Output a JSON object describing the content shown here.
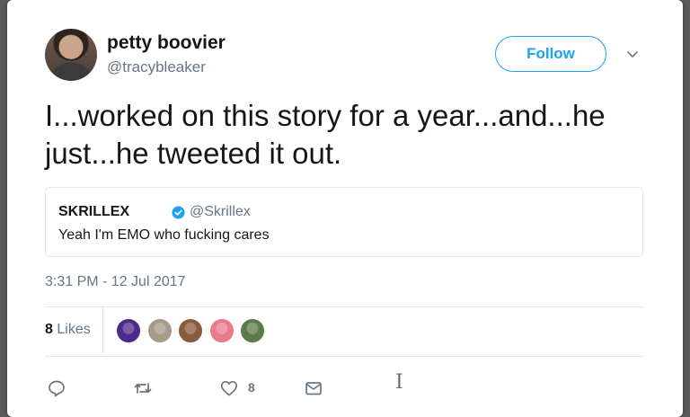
{
  "tweet": {
    "author_name": "petty boovier",
    "author_handle": "@tracybleaker",
    "follow_label": "Follow",
    "text": "I...worked on this story for a year...and...he just...he tweeted it out.",
    "timestamp": "3:31 PM - 12 Jul 2017",
    "likes_count": "8",
    "likes_label": "Likes",
    "like_action_count": "8"
  },
  "quoted_tweet": {
    "author_name": "SKRILLEX",
    "author_handle": "@Skrillex",
    "text": "Yeah I'm EMO who fucking cares",
    "verified": true
  },
  "likers": [
    {
      "name": "liker-avatar-1",
      "color": "#4b2a8a"
    },
    {
      "name": "liker-avatar-2",
      "color": "#a79a86"
    },
    {
      "name": "liker-avatar-3",
      "color": "#8a5a3c"
    },
    {
      "name": "liker-avatar-4",
      "color": "#e87a8c"
    },
    {
      "name": "liker-avatar-5",
      "color": "#5f7a4a"
    }
  ],
  "icons": {
    "reply": "reply-icon",
    "retweet": "retweet-icon",
    "like": "heart-icon",
    "message": "envelope-icon",
    "menu": "chevron-down-icon",
    "verified": "verified-badge-icon"
  },
  "colors": {
    "accent": "#1da1f2",
    "secondary_text": "#657786",
    "primary_text": "#14171a"
  }
}
